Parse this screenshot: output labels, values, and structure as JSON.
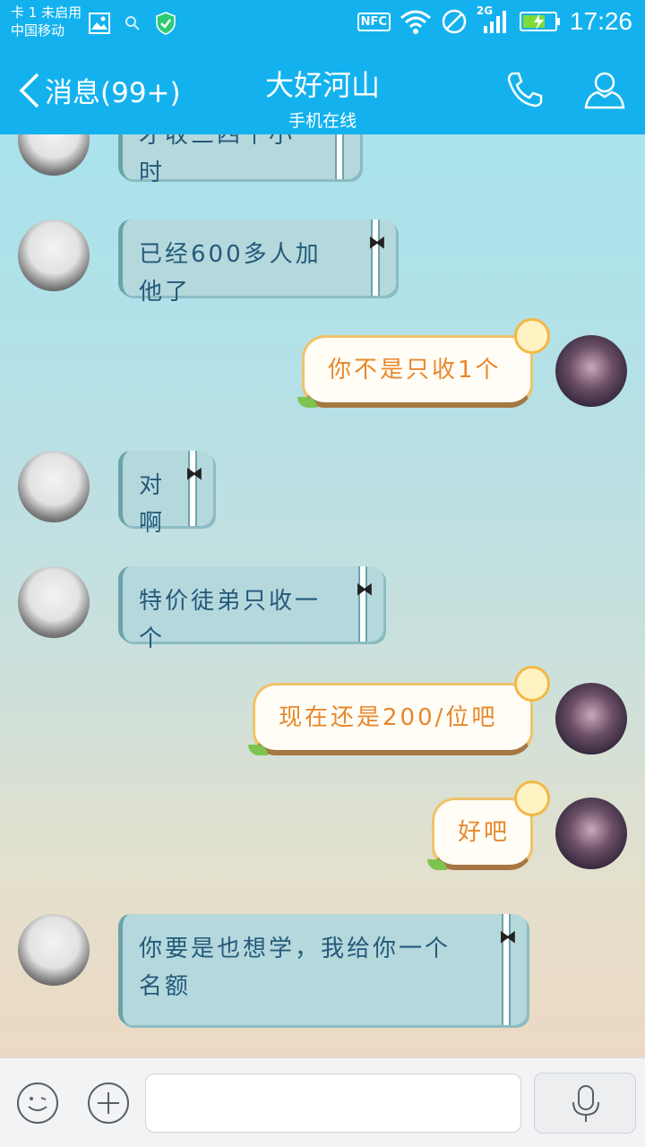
{
  "status_bar": {
    "sim_status": "卡 1 未启用",
    "carrier": "中国移动",
    "time": "17:26",
    "network_label": "2G",
    "nfc_label": "NFC"
  },
  "header": {
    "back_label": "消息(99+)",
    "contact_name": "大好河山",
    "contact_status": "手机在线"
  },
  "messages": [
    {
      "side": "them",
      "text": "才收三四个小时"
    },
    {
      "side": "them",
      "text": "已经600多人加他了"
    },
    {
      "side": "me",
      "text": "你不是只收1个"
    },
    {
      "side": "them",
      "text": "对啊"
    },
    {
      "side": "them",
      "text": "特价徒弟只收一个"
    },
    {
      "side": "me",
      "text": "现在还是200/位吧"
    },
    {
      "side": "me",
      "text": "好吧"
    },
    {
      "side": "them",
      "text": "你要是也想学，我给你一个名额"
    }
  ],
  "input": {
    "value": "",
    "placeholder": ""
  },
  "colors": {
    "header_bg": "#13b2ee",
    "them_bubble": "#b5d8dd",
    "them_text": "#245a7a",
    "me_bubble_border": "#f0c36a",
    "me_text": "#e8872b"
  },
  "icons": {
    "back": "chevron-left-icon",
    "phone": "phone-icon",
    "profile": "profile-icon",
    "emoji": "emoji-icon",
    "plus": "plus-icon",
    "mic": "mic-icon"
  }
}
